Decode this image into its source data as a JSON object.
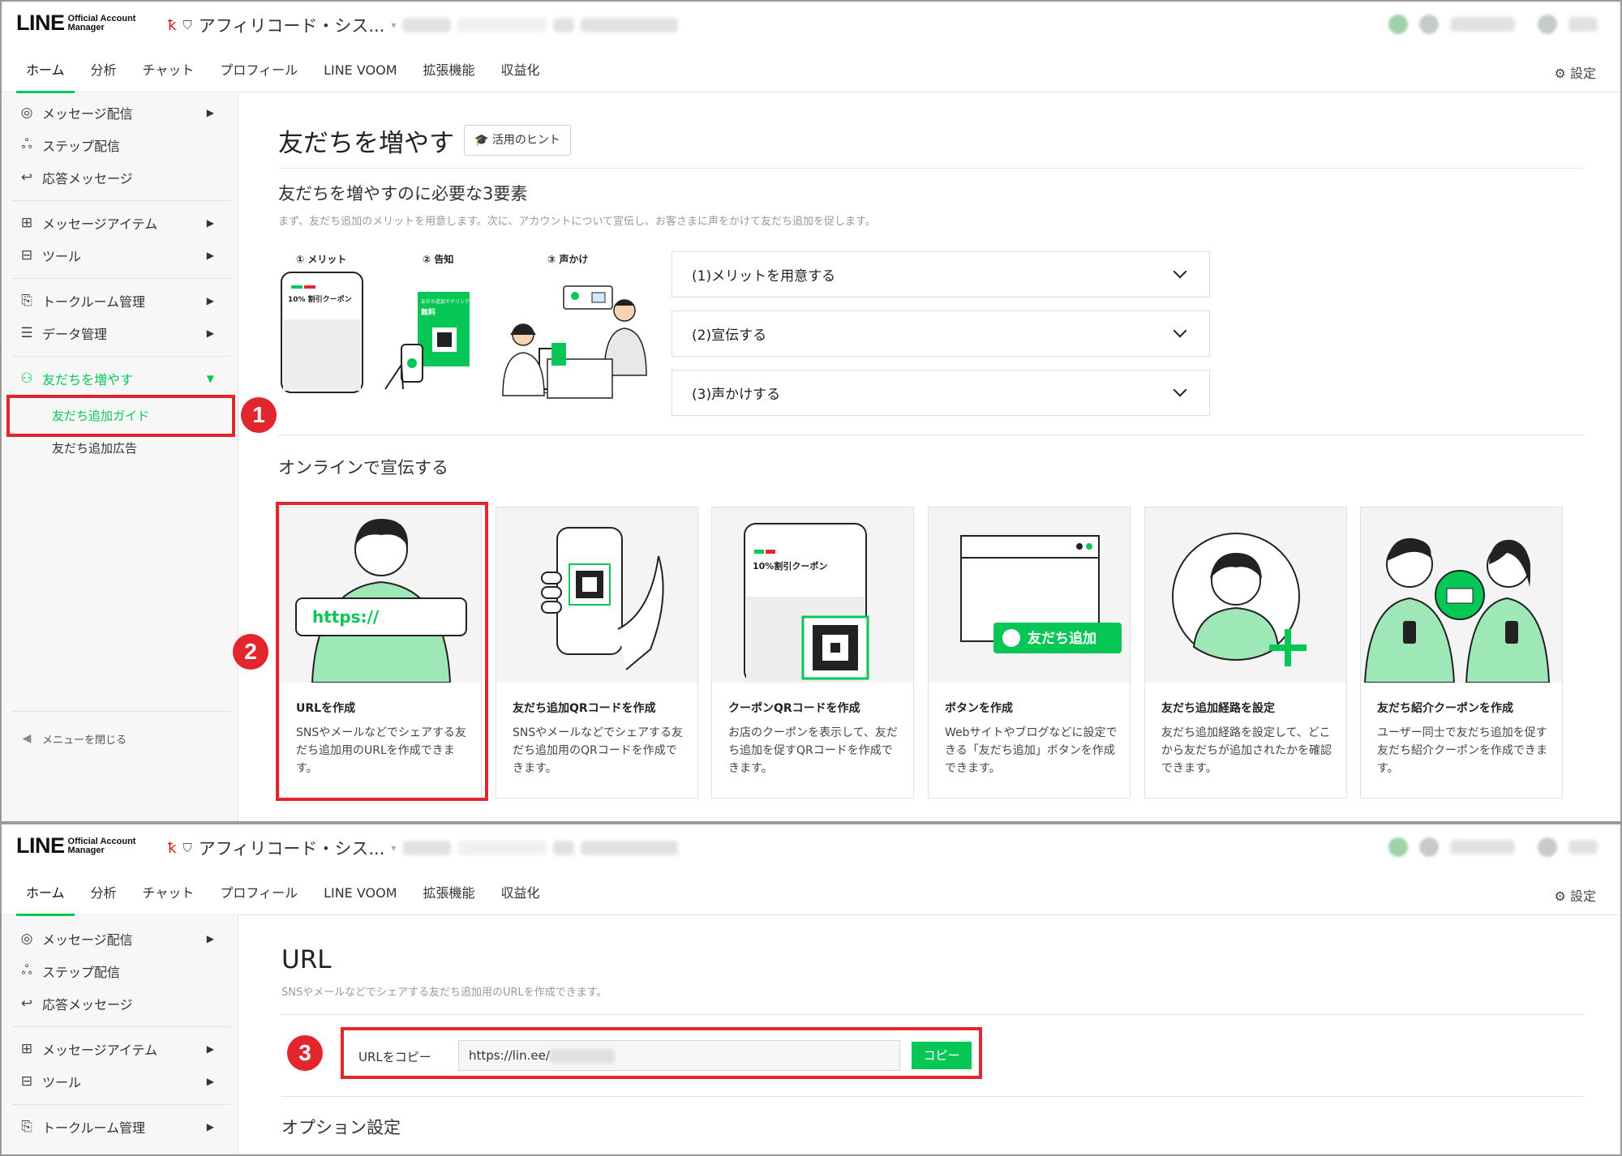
{
  "header": {
    "logo_main": "LINE",
    "logo_sub1": "Official Account",
    "logo_sub2": "Manager",
    "account_name": "アフィリコード・シス..."
  },
  "tabs": [
    "ホーム",
    "分析",
    "チャット",
    "プロフィール",
    "LINE VOOM",
    "拡張機能",
    "収益化"
  ],
  "settings_label": "設定",
  "sidebar": {
    "items": [
      {
        "label": "メッセージ配信",
        "icon": "broadcast-icon"
      },
      {
        "label": "ステップ配信",
        "icon": "step-icon"
      },
      {
        "label": "応答メッセージ",
        "icon": "reply-icon"
      },
      {
        "label": "メッセージアイテム",
        "icon": "message-item-icon"
      },
      {
        "label": "ツール",
        "icon": "tool-icon"
      },
      {
        "label": "トークルーム管理",
        "icon": "talkroom-icon"
      },
      {
        "label": "データ管理",
        "icon": "database-icon"
      },
      {
        "label": "友だちを増やす",
        "icon": "add-friend-icon"
      }
    ],
    "sub_items": [
      "友だち追加ガイド",
      "友だち追加広告"
    ],
    "collapse_label": "メニューを閉じる"
  },
  "guide": {
    "title": "友だちを増やす",
    "hint_button": "活用のヒント",
    "section_title": "友だちを増やすのに必要な3要素",
    "section_desc": "まず、友だち追加のメリットを用意します。次に、アカウントについて宣伝し、お客さまに声をかけて友だち追加を促します。",
    "steps": [
      "① メリット",
      "② 告知",
      "③ 声かけ"
    ],
    "illus_coupon": "10% 割引クーポン",
    "illus_poster_line1": "友だち追加でドリンク",
    "illus_poster_line2": "無料",
    "accordion": [
      "(1)メリットを用意する",
      "(2)宣伝する",
      "(3)声かけする"
    ],
    "online_title": "オンラインで宣伝する",
    "cards": [
      {
        "title": "URLを作成",
        "desc": "SNSやメールなどでシェアする友だち追加用のURLを作成できます。",
        "illus_text": "https://"
      },
      {
        "title": "友だち追加QRコードを作成",
        "desc": "SNSやメールなどでシェアする友だち追加用のQRコードを作成できます。"
      },
      {
        "title": "クーポンQRコードを作成",
        "desc": "お店のクーポンを表示して、友だち追加を促すQRコードを作成できます。",
        "illus_text": "10%割引クーポン"
      },
      {
        "title": "ボタンを作成",
        "desc": "Webサイトやブログなどに設定できる「友だち追加」ボタンを作成できます。",
        "illus_text": "友だち追加"
      },
      {
        "title": "友だち追加経路を設定",
        "desc": "友だち追加経路を設定して、どこから友だちが追加されたかを確認できます。"
      },
      {
        "title": "友だち紹介クーポンを作成",
        "desc": "ユーザー同士で友だち追加を促す友だち紹介クーポンを作成できます。"
      }
    ]
  },
  "url_page": {
    "title": "URL",
    "desc": "SNSやメールなどでシェアする友だち追加用のURLを作成できます。",
    "copy_label": "URLをコピー",
    "url_value": "https://lin.ee/",
    "copy_button": "コピー",
    "option_title": "オプション設定"
  },
  "badges": [
    "1",
    "2",
    "3"
  ],
  "colors": {
    "accent": "#06c755",
    "highlight": "#e3262d"
  }
}
